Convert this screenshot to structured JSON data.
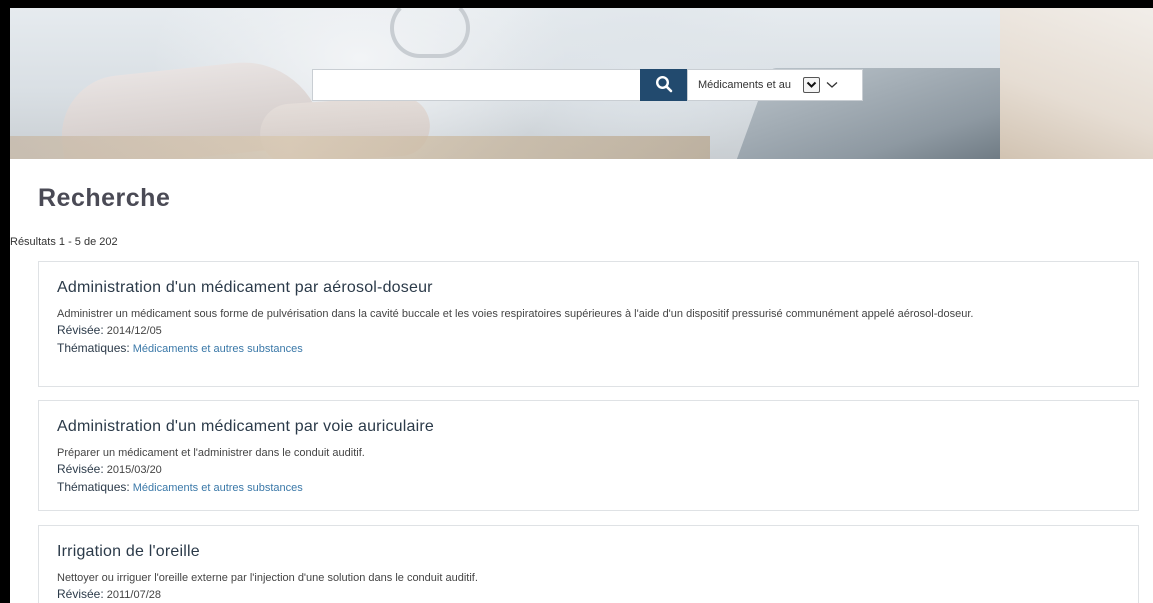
{
  "search": {
    "value": "",
    "placeholder": "",
    "scope_selected": "Médicaments et au",
    "search_icon": "search-icon",
    "colors": {
      "button": "#224a6e"
    }
  },
  "page": {
    "title": "Recherche",
    "results_count": "Résultats 1 - 5 de 202"
  },
  "labels": {
    "revised": "Révisée:",
    "themes": "Thématiques:"
  },
  "results": [
    {
      "title": "Administration d'un médicament par aérosol-doseur",
      "description": "Administrer un médicament sous forme de pulvérisation dans la cavité buccale et les voies respiratoires supérieures à l'aide d'un dispositif pressurisé communément appelé aérosol-doseur.",
      "revised": "2014/12/05",
      "theme": "Médicaments et autres substances"
    },
    {
      "title": "Administration d'un médicament par voie auriculaire",
      "description": "Préparer un médicament et l'administrer dans le conduit auditif.",
      "revised": "2015/03/20",
      "theme": "Médicaments et autres substances"
    },
    {
      "title": "Irrigation de l'oreille",
      "description": "Nettoyer ou irriguer l'oreille externe par l'injection d'une solution dans le conduit auditif.",
      "revised": "2011/07/28",
      "theme": ""
    }
  ]
}
